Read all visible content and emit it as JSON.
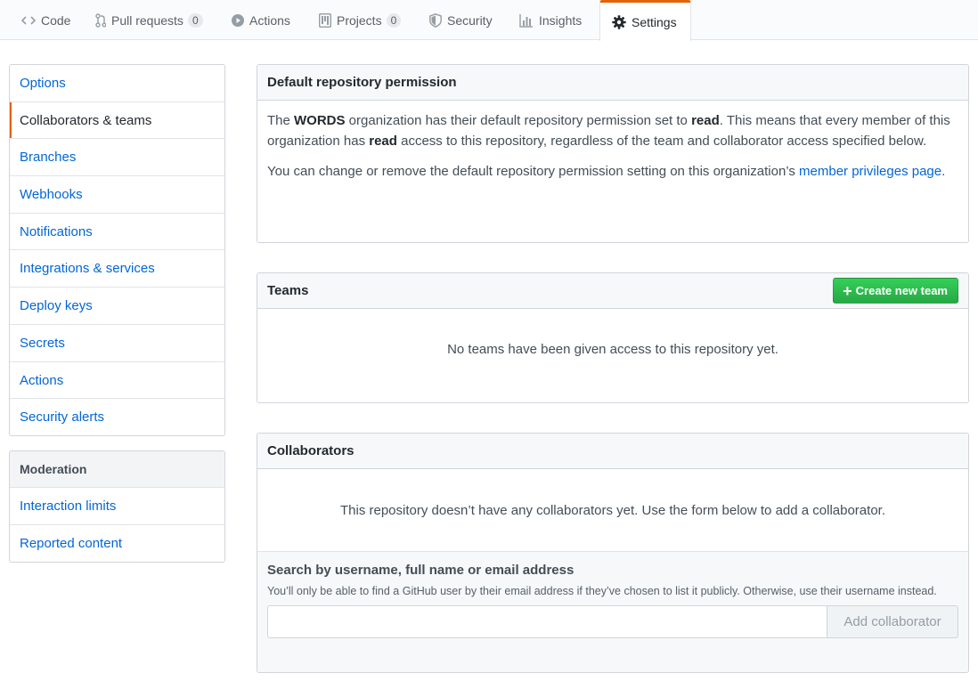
{
  "tabs": [
    {
      "label": "Code",
      "icon": "code-icon",
      "counter": null
    },
    {
      "label": "Pull requests",
      "icon": "pull-request-icon",
      "counter": "0"
    },
    {
      "label": "Actions",
      "icon": "play-icon",
      "counter": null
    },
    {
      "label": "Projects",
      "icon": "project-icon",
      "counter": "0"
    },
    {
      "label": "Security",
      "icon": "shield-icon",
      "counter": null
    },
    {
      "label": "Insights",
      "icon": "graph-icon",
      "counter": null
    },
    {
      "label": "Settings",
      "icon": "gear-icon",
      "counter": null,
      "selected": true
    }
  ],
  "sidebar": {
    "items": [
      "Options",
      "Collaborators & teams",
      "Branches",
      "Webhooks",
      "Notifications",
      "Integrations & services",
      "Deploy keys",
      "Secrets",
      "Actions",
      "Security alerts"
    ],
    "selected_index": 1,
    "moderation": {
      "heading": "Moderation",
      "items": [
        "Interaction limits",
        "Reported content"
      ]
    }
  },
  "default_permission": {
    "title": "Default repository permission",
    "p1_a": "The ",
    "org": "WORDS",
    "p1_b": " organization has their default repository permission set to ",
    "perm1": "read",
    "p1_c": ". This means that every member of this organization has ",
    "perm2": "read",
    "p1_d": " access to this repository, regardless of the team and collaborator access specified below.",
    "p2": "You can change or remove the default repository permission setting on this organization’s ",
    "p2_link": "member privileges page",
    "p2_end": "."
  },
  "teams": {
    "title": "Teams",
    "create_button": "Create new team",
    "blank": "No teams have been given access to this repository yet."
  },
  "collaborators": {
    "title": "Collaborators",
    "blank": "This repository doesn’t have any collaborators yet. Use the form below to add a collaborator.",
    "search_title": "Search by username, full name or email address",
    "search_note": "You’ll only be able to find a GitHub user by their email address if they’ve chosen to list it publicly. Otherwise, use their username instead.",
    "input_value": "",
    "add_button": "Add collaborator"
  },
  "colors": {
    "link": "#0366d6",
    "accent_tab": "#e36209",
    "button_green": "#28a745"
  }
}
